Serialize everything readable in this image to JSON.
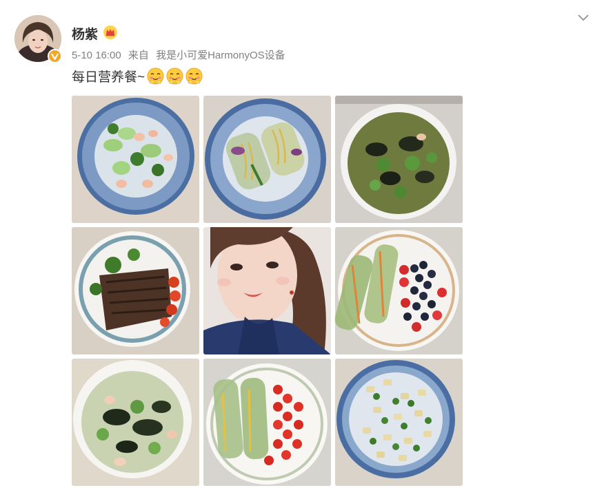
{
  "post": {
    "author": "杨紫",
    "date": "5-10 16:00",
    "from_label": "来自",
    "device": "我是小可爱HarmonyOS设备",
    "text": "每日营养餐~",
    "emojis": [
      "shy-smile-emoji",
      "shy-smile-emoji",
      "shy-smile-emoji"
    ]
  },
  "photos": [
    {
      "name": "photo-shrimp-broccoli"
    },
    {
      "name": "photo-noodle-spring-rolls"
    },
    {
      "name": "photo-fungus-soup"
    },
    {
      "name": "photo-beef-broccoli"
    },
    {
      "name": "photo-selfie"
    },
    {
      "name": "photo-rolls-berries"
    },
    {
      "name": "photo-seaweed-soup"
    },
    {
      "name": "photo-rolls-tomatoes"
    },
    {
      "name": "photo-cucumber-chicken"
    }
  ],
  "colors": {
    "verified_badge": "#f5a623",
    "text": "#333333",
    "meta_text": "#808080"
  }
}
